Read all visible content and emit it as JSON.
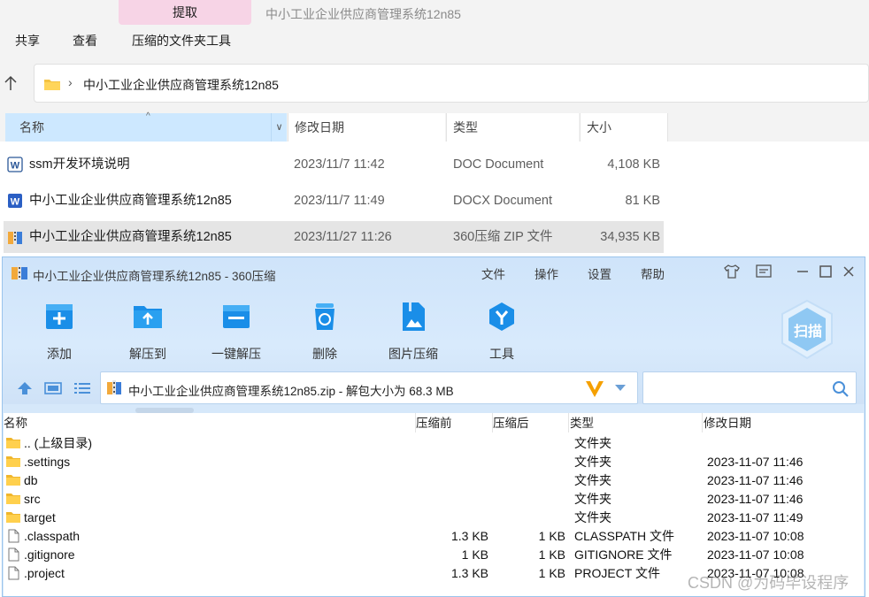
{
  "explorer": {
    "extract_tab": "提取",
    "window_title": "中小工业企业供应商管理系统12n85",
    "ribbon_tabs": [
      "共享",
      "查看",
      "压缩的文件夹工具"
    ],
    "address_path": "中小工业企业供应商管理系统12n85",
    "columns": [
      "名称",
      "修改日期",
      "类型",
      "大小"
    ],
    "files": [
      {
        "name": "ssm开发环境说明",
        "date": "2023/11/7 11:42",
        "type": "DOC Document",
        "size": "4,108 KB",
        "icon": "word-doc-icon"
      },
      {
        "name": "中小工业企业供应商管理系统12n85",
        "date": "2023/11/7 11:49",
        "type": "DOCX Document",
        "size": "81 KB",
        "icon": "word-docx-icon"
      },
      {
        "name": "中小工业企业供应商管理系统12n85",
        "date": "2023/11/27 11:26",
        "type": "360压缩 ZIP 文件",
        "size": "34,935 KB",
        "icon": "zip-archive-icon"
      }
    ]
  },
  "zipwin": {
    "title": "中小工业企业供应商管理系统12n85 - 360压缩",
    "menu": [
      "文件",
      "操作",
      "设置",
      "帮助"
    ],
    "tools": [
      "添加",
      "解压到",
      "一键解压",
      "删除",
      "图片压缩",
      "工具"
    ],
    "scan_label": "扫描",
    "path_text": "中小工业企业供应商管理系统12n85.zip - 解包大小为 68.3 MB",
    "columns": [
      "名称",
      "压缩前",
      "压缩后",
      "类型",
      "修改日期"
    ],
    "rows": [
      {
        "name": ".. (上级目录)",
        "before": "",
        "after": "",
        "type": "文件夹",
        "date": "",
        "kind": "folder"
      },
      {
        "name": ".settings",
        "before": "",
        "after": "",
        "type": "文件夹",
        "date": "2023-11-07 11:46",
        "kind": "folder"
      },
      {
        "name": "db",
        "before": "",
        "after": "",
        "type": "文件夹",
        "date": "2023-11-07 11:46",
        "kind": "folder"
      },
      {
        "name": "src",
        "before": "",
        "after": "",
        "type": "文件夹",
        "date": "2023-11-07 11:46",
        "kind": "folder"
      },
      {
        "name": "target",
        "before": "",
        "after": "",
        "type": "文件夹",
        "date": "2023-11-07 11:49",
        "kind": "folder"
      },
      {
        "name": ".classpath",
        "before": "1.3 KB",
        "after": "1 KB",
        "type": "CLASSPATH 文件",
        "date": "2023-11-07 10:08",
        "kind": "file"
      },
      {
        "name": ".gitignore",
        "before": "1 KB",
        "after": "1 KB",
        "type": "GITIGNORE 文件",
        "date": "2023-11-07 10:08",
        "kind": "file"
      },
      {
        "name": ".project",
        "before": "1.3 KB",
        "after": "1 KB",
        "type": "PROJECT 文件",
        "date": "2023-11-07 10:08",
        "kind": "file"
      }
    ]
  },
  "watermark": "CSDN @为码毕设程序"
}
